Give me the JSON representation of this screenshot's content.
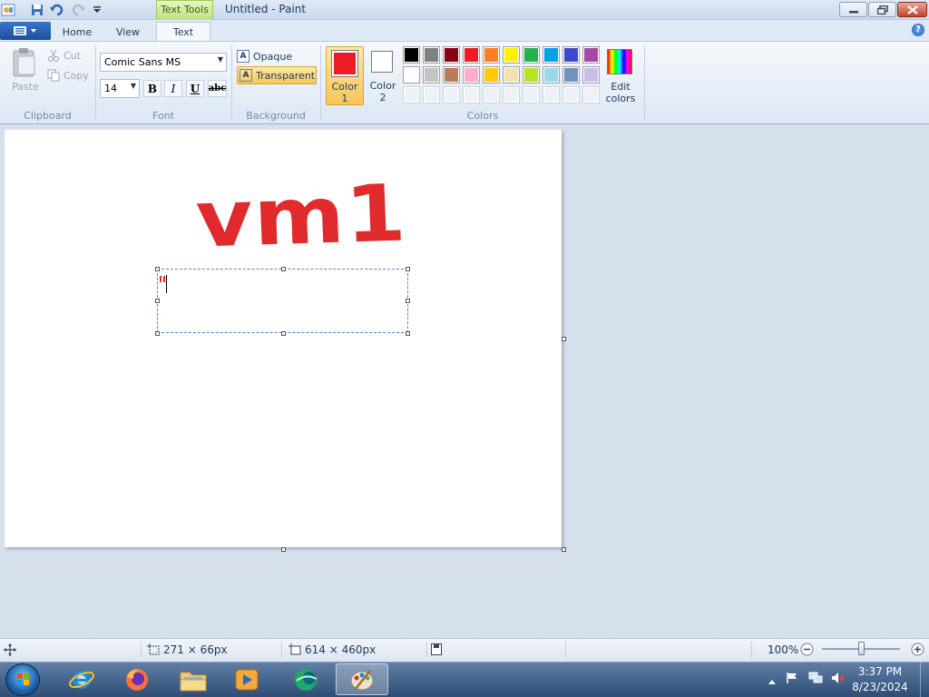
{
  "window": {
    "title": "Untitled - Paint",
    "context_tab": "Text Tools"
  },
  "tabs": [
    {
      "label": "Home"
    },
    {
      "label": "View"
    },
    {
      "label": "Text"
    }
  ],
  "ribbon": {
    "clipboard": {
      "label": "Clipboard",
      "paste": "Paste",
      "cut": "Cut",
      "copy": "Copy"
    },
    "font": {
      "label": "Font",
      "family": "Comic Sans MS",
      "size": "14",
      "bold": "B",
      "italic": "I",
      "underline": "U",
      "strike": "abc"
    },
    "background": {
      "label": "Background",
      "opaque": "Opaque",
      "transparent": "Transparent",
      "selected": "transparent"
    },
    "colors": {
      "label": "Colors",
      "color1_label": [
        "Color",
        "1"
      ],
      "color2_label": [
        "Color",
        "2"
      ],
      "color1_value": "#ed1c24",
      "color2_value": "#ffffff",
      "edit_label": [
        "Edit",
        "colors"
      ],
      "palette_row1": [
        "#000000",
        "#7f7f7f",
        "#880015",
        "#ed1c24",
        "#ff7f27",
        "#fff200",
        "#22b14c",
        "#00a2e8",
        "#3f48cc",
        "#a349a4"
      ],
      "palette_row2": [
        "#ffffff",
        "#c3c3c3",
        "#b97a57",
        "#ffaec9",
        "#ffc90e",
        "#efe4b0",
        "#b5e61d",
        "#99d9ea",
        "#7092be",
        "#c8bfe7"
      ]
    }
  },
  "canvas": {
    "drawn_text": "vm1"
  },
  "status": {
    "selection_size": "271 × 66px",
    "canvas_size": "614 × 460px",
    "zoom": "100%",
    "zoom_level": 0.5
  },
  "taskbar": {
    "time": "3:37 PM",
    "date": "8/23/2024"
  }
}
